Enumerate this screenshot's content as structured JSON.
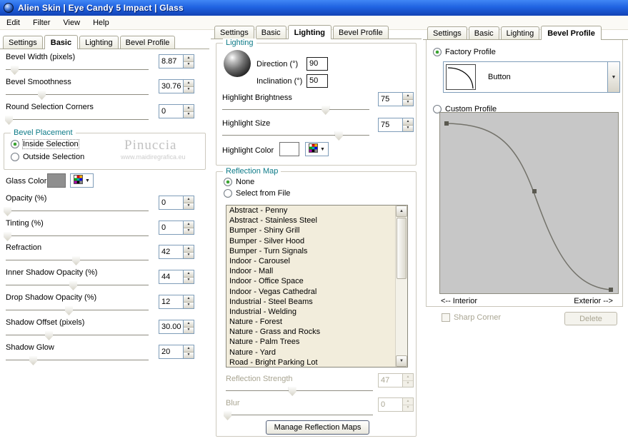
{
  "titlebar": {
    "title": "Alien Skin  |  Eye Candy 5 Impact  |  Glass"
  },
  "menubar": {
    "items": [
      "Edit",
      "Filter",
      "View",
      "Help"
    ]
  },
  "tab_labels": [
    "Settings",
    "Basic",
    "Lighting",
    "Bevel Profile"
  ],
  "icons": {
    "spin_up": "▲",
    "spin_down": "▼",
    "dropdown_arrow": "▼",
    "scroll_up": "▲",
    "scroll_down": "▼"
  },
  "left": {
    "rows": [
      {
        "label": "Bevel Width (pixels)",
        "value": "8.87",
        "thumb": "6%"
      },
      {
        "label": "Bevel Smoothness",
        "value": "30.76",
        "thumb": "25%"
      },
      {
        "label": "Round Selection Corners",
        "value": "0",
        "thumb": "2%"
      },
      {
        "label": "Opacity (%)",
        "value": "0",
        "thumb": "1%"
      },
      {
        "label": "Tinting (%)",
        "value": "0",
        "thumb": "1%"
      },
      {
        "label": "Refraction",
        "value": "42",
        "thumb": "49%"
      },
      {
        "label": "Inner Shadow Opacity (%)",
        "value": "44",
        "thumb": "47%"
      },
      {
        "label": "Drop Shadow Opacity (%)",
        "value": "12",
        "thumb": "44%"
      },
      {
        "label": "Shadow Offset (pixels)",
        "value": "30.00",
        "thumb": "30%"
      },
      {
        "label": "Shadow Glow",
        "value": "20",
        "thumb": "19%"
      }
    ],
    "bevel_placement": {
      "title": "Bevel Placement",
      "option_inside": "Inside Selection",
      "option_outside": "Outside Selection",
      "watermark_name": "Pinuccia",
      "watermark_url": "www.maidiregrafica.eu"
    },
    "glass_color_label": "Glass Color"
  },
  "middle": {
    "lighting": {
      "title": "Lighting",
      "direction_label": "Direction (°)",
      "direction_value": "90",
      "inclination_label": "Inclination (°)",
      "inclination_value": "50",
      "brightness_label": "Highlight Brightness",
      "brightness_value": "75",
      "brightness_thumb": "70%",
      "size_label": "Highlight Size",
      "size_value": "75",
      "size_thumb": "79%",
      "color_label": "Highlight Color"
    },
    "reflection": {
      "title": "Reflection Map",
      "option_none": "None",
      "option_file": "Select from File",
      "maps": [
        "Abstract - Penny",
        "Abstract - Stainless Steel",
        "Bumper - Shiny Grill",
        "Bumper - Silver Hood",
        "Bumper - Turn Signals",
        "Indoor - Carousel",
        "Indoor - Mall",
        "Indoor - Office Space",
        "Indoor - Vegas Cathedral",
        "Industrial - Steel Beams",
        "Industrial - Welding",
        "Nature - Forest",
        "Nature - Grass and Rocks",
        "Nature - Palm Trees",
        "Nature - Yard",
        "Road - Bright Parking Lot"
      ],
      "strength_label": "Reflection Strength",
      "strength_value": "47",
      "strength_thumb": "45%",
      "blur_label": "Blur",
      "blur_value": "0",
      "blur_thumb": "1%",
      "manage_button": "Manage Reflection Maps"
    }
  },
  "right": {
    "factory_option": "Factory Profile",
    "profile_name": "Button",
    "custom_option": "Custom Profile",
    "interior_label": "<-- Interior",
    "exterior_label": "Exterior -->",
    "sharp_corner": "Sharp Corner",
    "delete_button": "Delete"
  }
}
